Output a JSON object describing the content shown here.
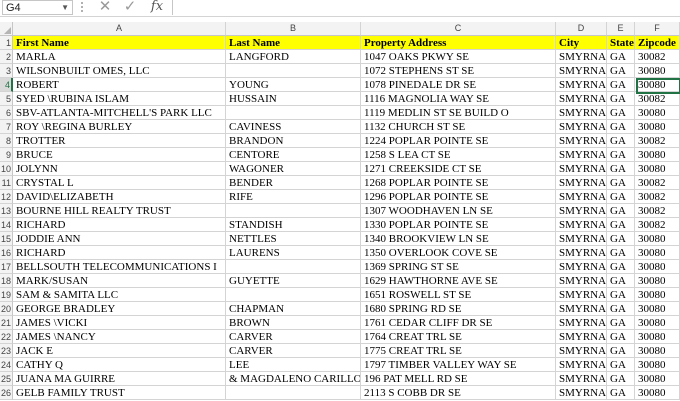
{
  "formula_bar": {
    "name_box": "G4",
    "cancel_icon": "✕",
    "enter_icon": "✓",
    "fx_label": "fx",
    "formula": ""
  },
  "columns": [
    "A",
    "B",
    "C",
    "D",
    "E",
    "F"
  ],
  "header": [
    "First Name",
    "Last Name",
    "Property Address",
    "City",
    "State",
    "Zipcode"
  ],
  "rows": [
    [
      "MARLA",
      "LANGFORD",
      "1047 OAKS PKWY SE",
      "SMYRNA",
      "GA",
      "30082"
    ],
    [
      "WILSONBUILT OMES, LLC",
      "",
      "1072 STEPHENS ST SE",
      "SMYRNA",
      "GA",
      "30080"
    ],
    [
      "ROBERT",
      "YOUNG",
      "1078 PINEDALE DR SE",
      "SMYRNA",
      "GA",
      "30080"
    ],
    [
      "SYED \\RUBINA  ISLAM",
      "HUSSAIN",
      "1116 MAGNOLIA WAY SE",
      "SMYRNA",
      "GA",
      "30082"
    ],
    [
      "SBV-ATLANTA-MITCHELL'S PARK LLC",
      "",
      "1119 MEDLIN ST SE BUILD O",
      "SMYRNA",
      "GA",
      "30080"
    ],
    [
      "ROY \\REGINA BURLEY",
      "CAVINESS",
      "1132 CHURCH ST SE",
      "SMYRNA",
      "GA",
      "30080"
    ],
    [
      "TROTTER",
      "BRANDON",
      "1224 POPLAR POINTE SE",
      "SMYRNA",
      "GA",
      "30082"
    ],
    [
      "BRUCE",
      "CENTORE",
      "1258 S LEA CT SE",
      "SMYRNA",
      "GA",
      "30080"
    ],
    [
      "JOLYNN",
      "WAGONER",
      "1271 CREEKSIDE CT SE",
      "SMYRNA",
      "GA",
      "30080"
    ],
    [
      "CRYSTAL L",
      "BENDER",
      "1268 POPLAR POINTE SE",
      "SMYRNA",
      "GA",
      "30082"
    ],
    [
      "DAVID\\ELIZABETH",
      "RIFE",
      "1296 POPLAR POINTE SE",
      "SMYRNA",
      "GA",
      "30082"
    ],
    [
      "BOURNE HILL REALTY TRUST",
      "",
      "1307 WOODHAVEN LN SE",
      "SMYRNA",
      "GA",
      "30082"
    ],
    [
      "RICHARD",
      "STANDISH",
      "1330 POPLAR POINTE SE",
      "SMYRNA",
      "GA",
      "30082"
    ],
    [
      "JODDIE ANN",
      "NETTLES",
      "1340 BROOKVIEW LN SE",
      "SMYRNA",
      "GA",
      "30080"
    ],
    [
      " RICHARD",
      "LAURENS",
      "1350 OVERLOOK COVE SE",
      "SMYRNA",
      "GA",
      "30080"
    ],
    [
      "BELLSOUTH TELECOMMUNICATIONS I",
      "",
      "1369 SPRING ST SE",
      "SMYRNA",
      "GA",
      "30080"
    ],
    [
      "MARK/SUSAN",
      "GUYETTE",
      "1629 HAWTHORNE AVE SE",
      "SMYRNA",
      "GA",
      "30080"
    ],
    [
      "SAM & SAMITA LLC",
      "",
      "1651 ROSWELL ST SE",
      "SMYRNA",
      "GA",
      "30080"
    ],
    [
      "GEORGE BRADLEY",
      " CHAPMAN",
      "1680 SPRING RD SE",
      "SMYRNA",
      "GA",
      "30080"
    ],
    [
      "JAMES \\VICKI",
      "BROWN",
      "1761 CEDAR CLIFF DR SE",
      "SMYRNA",
      "GA",
      "30080"
    ],
    [
      "JAMES \\NANCY",
      "CARVER",
      "1764 CREAT TRL SE",
      "SMYRNA",
      "GA",
      "30080"
    ],
    [
      "JACK E",
      "CARVER",
      "1775 CREAT TRL SE",
      "SMYRNA",
      "GA",
      "30080"
    ],
    [
      "CATHY Q",
      "LEE",
      "1797 TIMBER VALLEY WAY SE",
      "SMYRNA",
      "GA",
      "30080"
    ],
    [
      "JUANA MA GUIRRE",
      "& MAGDALENO CARILLO",
      "196 PAT MELL RD SE",
      "SMYRNA",
      "GA",
      "30080"
    ],
    [
      "GELB FAMILY TRUST",
      "",
      "2113 S COBB DR SE",
      "SMYRNA",
      "GA",
      "30080"
    ]
  ],
  "selected_row": 4
}
